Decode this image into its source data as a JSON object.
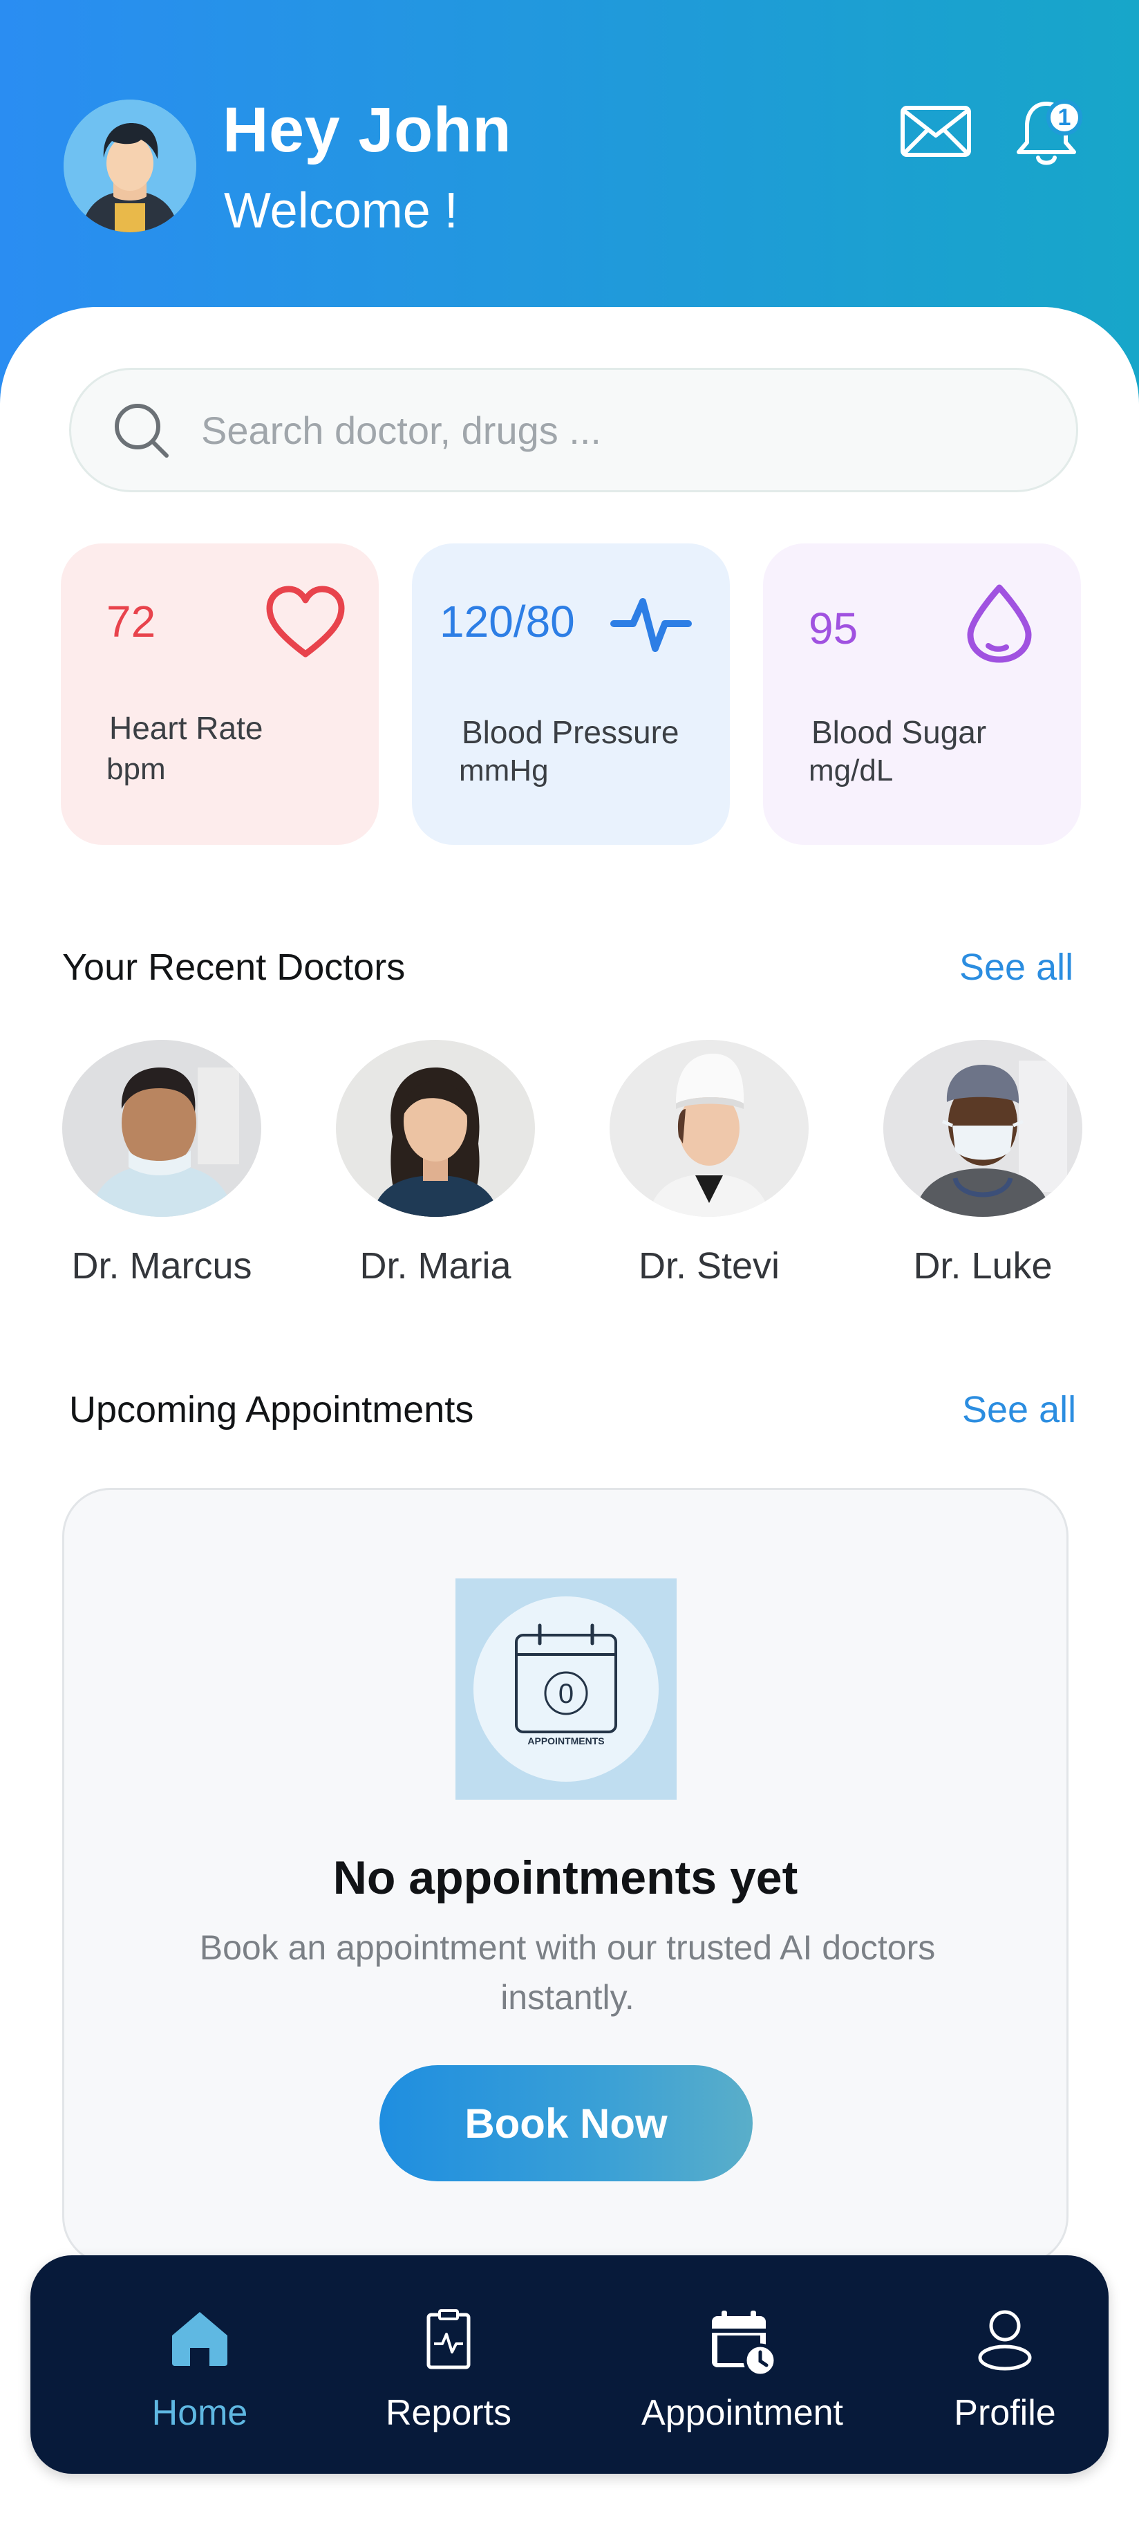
{
  "header": {
    "greeting": "Hey John",
    "welcome": "Welcome !",
    "notification_count": "1",
    "icons": [
      "user-avatar",
      "mail-icon",
      "bell-icon"
    ]
  },
  "search": {
    "placeholder": "Search doctor, drugs ..."
  },
  "vitals": [
    {
      "value": "72",
      "label": "Heart Rate",
      "unit": "bpm",
      "icon": "heart-icon",
      "color": "#e8434c"
    },
    {
      "value": "120/80",
      "label": "Blood Pressure",
      "unit": "mmHg",
      "icon": "pulse-icon",
      "color": "#2d7ee5"
    },
    {
      "value": "95",
      "label": "Blood Sugar",
      "unit": "mg/dL",
      "icon": "drop-icon",
      "color": "#a052e0"
    }
  ],
  "recent_doctors": {
    "title": "Your Recent Doctors",
    "see_all": "See all",
    "doctors": [
      {
        "name": "Dr. Marcus"
      },
      {
        "name": "Dr. Maria"
      },
      {
        "name": "Dr. Stevi"
      },
      {
        "name": "Dr. Luke"
      }
    ]
  },
  "appointments": {
    "title": "Upcoming Appointments",
    "see_all": "See all",
    "illustration_text": "APPOINTMENTS",
    "illustration_count": "0",
    "empty_title": "No appointments yet",
    "empty_desc": "Book an appointment with our trusted AI doctors instantly.",
    "book_label": "Book Now"
  },
  "nav": {
    "items": [
      {
        "label": "Home",
        "icon": "home-icon",
        "active": true
      },
      {
        "label": "Reports",
        "icon": "report-icon",
        "active": false
      },
      {
        "label": "Appointment",
        "icon": "calendar-clock-icon",
        "active": false
      },
      {
        "label": "Profile",
        "icon": "user-icon",
        "active": false
      }
    ]
  },
  "colors": {
    "header_gradient_start": "#2a8df2",
    "header_gradient_end": "#17a6c9",
    "accent": "#2b8de0",
    "nav_bg": "#071a3a",
    "nav_active": "#5fb8e2"
  }
}
